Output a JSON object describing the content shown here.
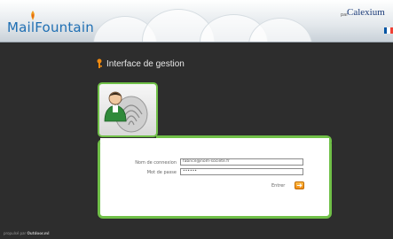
{
  "header": {
    "logo_text": "MailFountain",
    "brand_prefix": "par",
    "brand_name": "Calexium",
    "language_flag_colors": [
      "#0055a4",
      "#ffffff",
      "#ef4135"
    ]
  },
  "page": {
    "title": "Interface de gestion",
    "title_icon": "key-icon"
  },
  "avatar": {
    "icon": "user-fingerprint-icon"
  },
  "login": {
    "username_label": "Nom de connexion",
    "username_value": "fabrice@nom-societe.fr",
    "password_label": "Mot de passe",
    "password_value": "••••••",
    "enter_label": "Entrer",
    "enter_icon": "arrow-right-icon"
  },
  "footer": {
    "prefix": "propulsé par",
    "name": "Outdoor.ml"
  },
  "colors": {
    "accent_green": "#70c048",
    "background": "#2d2d2d",
    "logo_blue": "#1f6fb3"
  }
}
